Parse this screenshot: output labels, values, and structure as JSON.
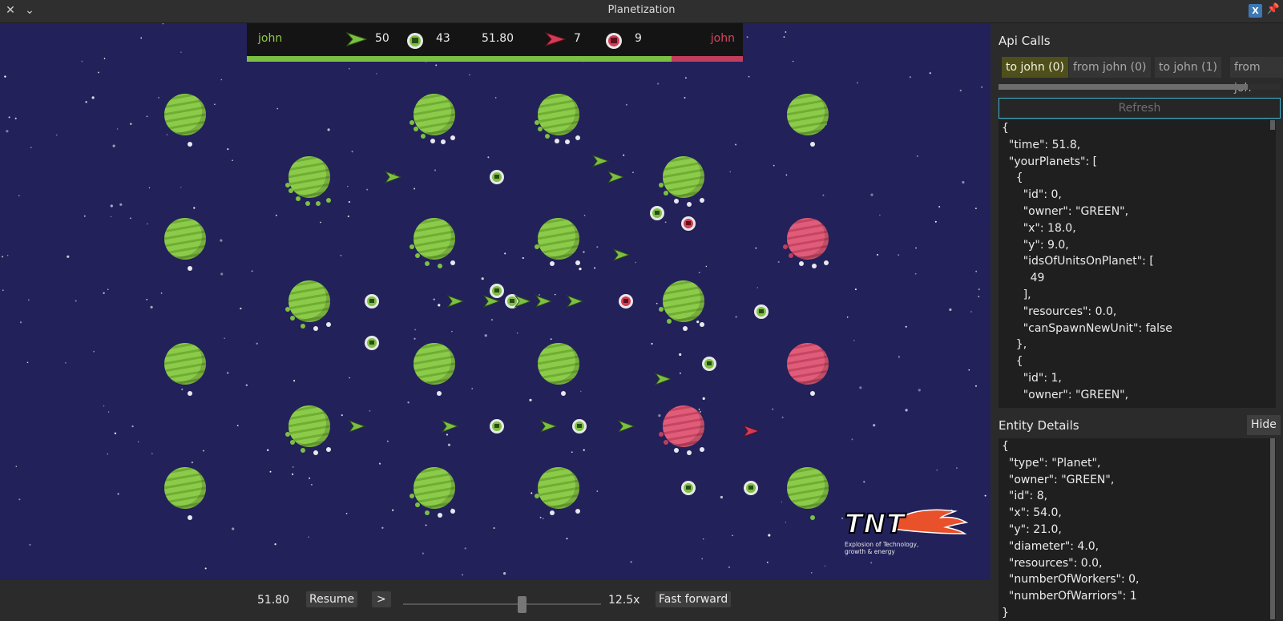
{
  "window": {
    "title": "Planetization"
  },
  "colors": {
    "space": "#22215a",
    "green": "#7cc043",
    "red": "#c23d5c",
    "tab_active": "#4f4f1b",
    "focus": "#3fb5d2"
  },
  "hud": {
    "left_player": "john",
    "left_warriors": "50",
    "left_workers": "43",
    "time": "51.80",
    "right_warriors": "7",
    "right_workers": "9",
    "right_player": "john",
    "green_share": 0.857
  },
  "controls": {
    "time": "51.80",
    "resume_label": "Resume",
    "step_label": ">",
    "speed": "12.5x",
    "fast_forward_label": "Fast forward",
    "speed_slider_value": 0.6
  },
  "logo": {
    "text": "TNT",
    "subtitle": "Explosion of Technology, growth & energy"
  },
  "api_calls": {
    "title": "Api Calls",
    "tabs": [
      "to john (0)",
      "from john (0)",
      "to john (1)",
      "from joh"
    ],
    "refresh_label": "Refresh",
    "json_lines": [
      "{",
      "  \"time\": 51.8,",
      "  \"yourPlanets\": [",
      "    {",
      "      \"id\": 0,",
      "      \"owner\": \"GREEN\",",
      "      \"x\": 18.0,",
      "      \"y\": 9.0,",
      "      \"idsOfUnitsOnPlanet\": [",
      "        49",
      "      ],",
      "      \"resources\": 0.0,",
      "      \"canSpawnNewUnit\": false",
      "    },",
      "    {",
      "      \"id\": 1,",
      "      \"owner\": \"GREEN\","
    ]
  },
  "entity_details": {
    "title": "Entity Details",
    "hide_label": "Hide",
    "json_lines": [
      "{",
      "  \"type\": \"Planet\",",
      "  \"owner\": \"GREEN\",",
      "  \"id\": 8,",
      "  \"x\": 54.0,",
      "  \"y\": 21.0,",
      "  \"diameter\": 4.0,",
      "  \"resources\": 0.0,",
      "  \"numberOfWorkers\": 0,",
      "  \"numberOfWarriors\": 1",
      "}"
    ]
  },
  "map": {
    "planets": [
      {
        "gx": 18,
        "gy": 9,
        "owner": "green",
        "ring": [
          "white"
        ]
      },
      {
        "gx": 42,
        "gy": 9,
        "owner": "green",
        "ring": [
          "green",
          "green",
          "green",
          "white",
          "white",
          "white"
        ]
      },
      {
        "gx": 54,
        "gy": 9,
        "owner": "green",
        "ring": [
          "green",
          "green",
          "green",
          "white",
          "white",
          "white"
        ]
      },
      {
        "gx": 78,
        "gy": 9,
        "owner": "green",
        "ring": [
          "white"
        ]
      },
      {
        "gx": 30,
        "gy": 15,
        "owner": "green",
        "ring": [
          "green",
          "green",
          "green",
          "green",
          "green",
          "green"
        ]
      },
      {
        "gx": 66,
        "gy": 15,
        "owner": "green",
        "ring": [
          "green",
          "green",
          "white",
          "white",
          "white"
        ]
      },
      {
        "gx": 18,
        "gy": 21,
        "owner": "green",
        "ring": [
          "white"
        ]
      },
      {
        "gx": 42,
        "gy": 21,
        "owner": "green",
        "ring": [
          "green",
          "green",
          "green",
          "green",
          "white"
        ]
      },
      {
        "gx": 54,
        "gy": 21,
        "owner": "green",
        "ring": [
          "green",
          "white",
          "white"
        ]
      },
      {
        "gx": 78,
        "gy": 21,
        "owner": "red",
        "ring": [
          "red",
          "red",
          "white",
          "white",
          "white"
        ]
      },
      {
        "gx": 30,
        "gy": 27,
        "owner": "green",
        "ring": [
          "green",
          "green",
          "green",
          "white",
          "white"
        ]
      },
      {
        "gx": 66,
        "gy": 27,
        "owner": "green",
        "ring": [
          "green",
          "green",
          "white",
          "white"
        ]
      },
      {
        "gx": 18,
        "gy": 33,
        "owner": "green",
        "ring": [
          "white"
        ]
      },
      {
        "gx": 42,
        "gy": 33,
        "owner": "green",
        "ring": [
          "white"
        ]
      },
      {
        "gx": 54,
        "gy": 33,
        "owner": "green",
        "ring": [
          "white"
        ]
      },
      {
        "gx": 78,
        "gy": 33,
        "owner": "red",
        "ring": [
          "white"
        ]
      },
      {
        "gx": 30,
        "gy": 39,
        "owner": "green",
        "ring": [
          "green",
          "green",
          "green",
          "white",
          "white"
        ]
      },
      {
        "gx": 66,
        "gy": 39,
        "owner": "red",
        "ring": [
          "red",
          "red",
          "white",
          "white",
          "white"
        ]
      },
      {
        "gx": 18,
        "gy": 45,
        "owner": "green",
        "ring": [
          "white"
        ]
      },
      {
        "gx": 42,
        "gy": 45,
        "owner": "green",
        "ring": [
          "green",
          "green",
          "green",
          "white",
          "white"
        ]
      },
      {
        "gx": 54,
        "gy": 45,
        "owner": "green",
        "ring": [
          "green",
          "white",
          "white"
        ]
      },
      {
        "gx": 78,
        "gy": 45,
        "owner": "green",
        "ring": [
          "green"
        ]
      }
    ],
    "units": [
      {
        "gx": 38,
        "gy": 15,
        "kind": "warrior",
        "team": "green"
      },
      {
        "gx": 48,
        "gy": 15,
        "kind": "worker",
        "team": "green"
      },
      {
        "gx": 58,
        "gy": 13.5,
        "kind": "warrior",
        "team": "green"
      },
      {
        "gx": 59.5,
        "gy": 15,
        "kind": "warrior",
        "team": "green"
      },
      {
        "gx": 63.5,
        "gy": 18.5,
        "kind": "worker",
        "team": "green"
      },
      {
        "gx": 66.5,
        "gy": 19.5,
        "kind": "worker",
        "team": "red"
      },
      {
        "gx": 60,
        "gy": 22.5,
        "kind": "warrior",
        "team": "green"
      },
      {
        "gx": 36,
        "gy": 27,
        "kind": "worker",
        "team": "green"
      },
      {
        "gx": 44,
        "gy": 27,
        "kind": "warrior",
        "team": "green"
      },
      {
        "gx": 48,
        "gy": 26,
        "kind": "worker",
        "team": "green"
      },
      {
        "gx": 47.5,
        "gy": 27,
        "kind": "warrior",
        "team": "green"
      },
      {
        "gx": 49.5,
        "gy": 27,
        "kind": "worker",
        "team": "green"
      },
      {
        "gx": 50.5,
        "gy": 27,
        "kind": "warrior",
        "team": "green"
      },
      {
        "gx": 52.5,
        "gy": 27,
        "kind": "warrior",
        "team": "green"
      },
      {
        "gx": 55.5,
        "gy": 27,
        "kind": "warrior",
        "team": "green"
      },
      {
        "gx": 60.5,
        "gy": 27,
        "kind": "worker",
        "team": "red"
      },
      {
        "gx": 73.5,
        "gy": 28,
        "kind": "worker",
        "team": "green"
      },
      {
        "gx": 36,
        "gy": 31,
        "kind": "worker",
        "team": "green"
      },
      {
        "gx": 68.5,
        "gy": 33,
        "kind": "worker",
        "team": "green"
      },
      {
        "gx": 64,
        "gy": 34.5,
        "kind": "warrior",
        "team": "green"
      },
      {
        "gx": 34.5,
        "gy": 39,
        "kind": "warrior",
        "team": "green"
      },
      {
        "gx": 43.5,
        "gy": 39,
        "kind": "warrior",
        "team": "green"
      },
      {
        "gx": 48,
        "gy": 39,
        "kind": "worker",
        "team": "green"
      },
      {
        "gx": 53,
        "gy": 39,
        "kind": "warrior",
        "team": "green"
      },
      {
        "gx": 56,
        "gy": 39,
        "kind": "worker",
        "team": "green"
      },
      {
        "gx": 60.5,
        "gy": 39,
        "kind": "warrior",
        "team": "green"
      },
      {
        "gx": 72.5,
        "gy": 39.5,
        "kind": "warrior",
        "team": "red"
      },
      {
        "gx": 66.5,
        "gy": 45,
        "kind": "worker",
        "team": "green"
      },
      {
        "gx": 72.5,
        "gy": 45,
        "kind": "worker",
        "team": "green"
      }
    ]
  }
}
